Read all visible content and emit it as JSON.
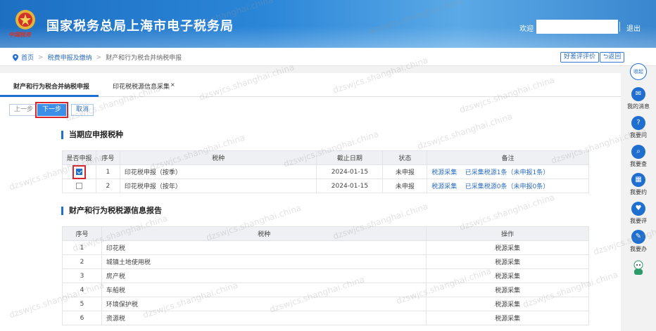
{
  "header": {
    "emblem_text": "中国税务",
    "title": "国家税务总局上海市电子税务局",
    "welcome": "欢迎",
    "logout": "退出"
  },
  "breadcrumb": {
    "home": "首页",
    "level1": "税费申报及缴纳",
    "current": "财产和行为税合并纳税申报"
  },
  "actions": {
    "evaluate": "好差评评价",
    "back": "返回"
  },
  "tabs": [
    {
      "label": "财产和行为税合并纳税申报",
      "active": true
    },
    {
      "label": "印花税税源信息采集",
      "active": false,
      "closable": true
    }
  ],
  "buttons": {
    "prev": "上一步",
    "next": "下一步",
    "cancel": "取消"
  },
  "section1": {
    "title": "当期应申报税种",
    "headers": [
      "是否申报",
      "序号",
      "税种",
      "截止日期",
      "状态",
      "备注"
    ],
    "rows": [
      {
        "checked": true,
        "no": "1",
        "tax": "印花税申报（按季）",
        "deadline": "2024-01-15",
        "status": "未申报",
        "link1": "税源采集",
        "link2": "已采集税源1条（未申报1条）"
      },
      {
        "checked": false,
        "no": "2",
        "tax": "印花税申报（按年）",
        "deadline": "2024-01-15",
        "status": "未申报",
        "link1": "税源采集",
        "link2": "已采集税源0条（未申报0条）"
      }
    ]
  },
  "section2": {
    "title": "财产和行为税税源信息报告",
    "headers": [
      "序号",
      "税种",
      "操作"
    ],
    "rows": [
      {
        "no": "1",
        "tax": "印花税",
        "op": "税源采集"
      },
      {
        "no": "2",
        "tax": "城镇土地使用税",
        "op": "税源采集"
      },
      {
        "no": "3",
        "tax": "房产税",
        "op": "税源采集"
      },
      {
        "no": "4",
        "tax": "车船税",
        "op": "税源采集"
      },
      {
        "no": "5",
        "tax": "环境保护税",
        "op": "税源采集"
      },
      {
        "no": "6",
        "tax": "资源税",
        "op": "税源采集"
      }
    ]
  },
  "sidebar": {
    "top": "收起",
    "items": [
      {
        "label": "我的消息",
        "icon": "message-icon"
      },
      {
        "label": "我要问",
        "icon": "question-icon"
      },
      {
        "label": "我要查",
        "icon": "search-icon"
      },
      {
        "label": "我要约",
        "icon": "calendar-icon"
      },
      {
        "label": "我要评",
        "icon": "rate-icon"
      },
      {
        "label": "我要办",
        "icon": "edit-icon"
      }
    ]
  },
  "watermark": "dzswjcs.shanghai.china",
  "colors": {
    "primary": "#1e6fd0",
    "highlight": "#d9262c",
    "link": "#2c6dbd"
  }
}
